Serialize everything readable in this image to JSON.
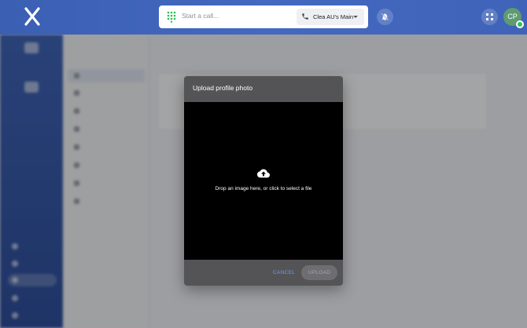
{
  "topbar": {
    "search_placeholder": "Start a call...",
    "line_selector": {
      "selected": "Clea AU's Main"
    },
    "avatar_initials": "CP",
    "icons": {
      "logo": "x-logo-icon",
      "dialpad": "dialpad-icon",
      "phone": "phone-icon",
      "bell": "bell-off-icon",
      "grid": "grid-icon"
    }
  },
  "dialog": {
    "title": "Upload profile photo",
    "dropzone_text": "Drop an image here, or click to select a file",
    "upload_icon": "cloud-upload-icon",
    "cancel_label": "CANCEL",
    "upload_label": "UPLOAD"
  },
  "colors": {
    "topbar": "#4369c0",
    "dialog_bg": "#545457",
    "dropzone_bg": "#000000",
    "cancel_text": "#6f9cf0",
    "presence": "#2fbf5a",
    "avatar_bg": "#5f9a72"
  }
}
